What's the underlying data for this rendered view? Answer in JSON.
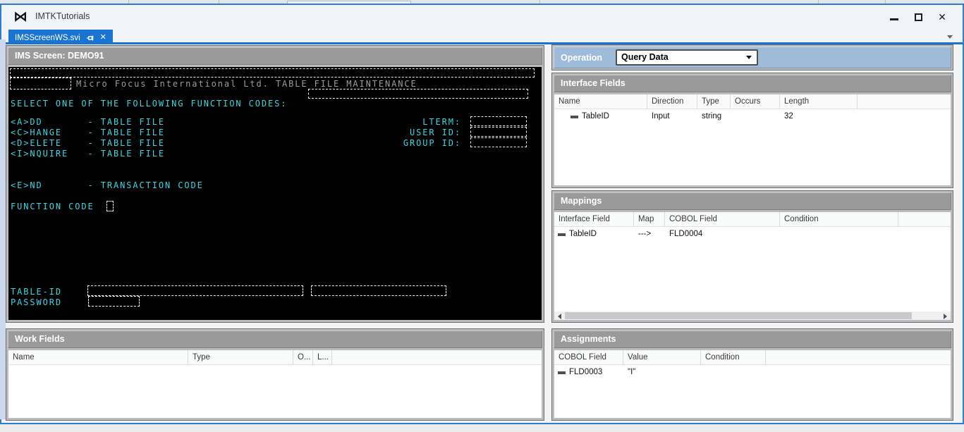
{
  "icons": {
    "vs_logo": "⋈",
    "close": "✕"
  },
  "window": {
    "title": "IMTKTutorials"
  },
  "tab": {
    "label": "IMSScreenWS.svi"
  },
  "terminal": {
    "header": "IMS Screen: DEMO91",
    "banner": "Micro Focus International Ltd. TABLE FILE MAINTENANCE",
    "select_line": "SELECT ONE OF THE FOLLOWING FUNCTION CODES:",
    "lines": [
      {
        "text": "<A>DD       - TABLE FILE",
        "right_label": "LTERM:"
      },
      {
        "text": "<C>HANGE    - TABLE FILE",
        "right_label": "USER ID:"
      },
      {
        "text": "<D>ELETE    - TABLE FILE",
        "right_label": "GROUP ID:"
      },
      {
        "text": "<I>NQUIRE   - TABLE FILE",
        "right_label": ""
      }
    ],
    "end_line": "<E>ND       - TRANSACTION CODE",
    "function_code_label": "FUNCTION CODE",
    "table_id_label": "TABLE-ID",
    "password_label": "PASSWORD"
  },
  "operation": {
    "label": "Operation",
    "selected_value": "Query Data"
  },
  "interface_fields": {
    "title": "Interface Fields",
    "columns": [
      "Name",
      "Direction",
      "Type",
      "Occurs",
      "Length"
    ],
    "rows": [
      {
        "name": "TableID",
        "direction": "Input",
        "type": "string",
        "occurs": "",
        "length": "32"
      }
    ]
  },
  "mappings": {
    "title": "Mappings",
    "columns": [
      "Interface Field",
      "Map",
      "COBOL Field",
      "Condition"
    ],
    "rows": [
      {
        "interface_field": "TableID",
        "map": "--->",
        "cobol_field": "FLD0004",
        "condition": ""
      }
    ]
  },
  "work_fields": {
    "title": "Work Fields",
    "columns": [
      "Name",
      "Type",
      "O...",
      "L..."
    ],
    "rows": []
  },
  "assignments": {
    "title": "Assignments",
    "columns": [
      "COBOL Field",
      "Value",
      "Condition"
    ],
    "rows": [
      {
        "cobol_field": "FLD0003",
        "value": "\"I\"",
        "condition": ""
      }
    ]
  },
  "colors": {
    "accent_blue": "#1a75d2",
    "window_border": "#2e7cd4",
    "terminal_cyan": "#38d7e2",
    "terminal_gray": "#9c9c9c",
    "panel_header_gray": "#9a9a9a",
    "operation_blue": "#9fbbda"
  }
}
